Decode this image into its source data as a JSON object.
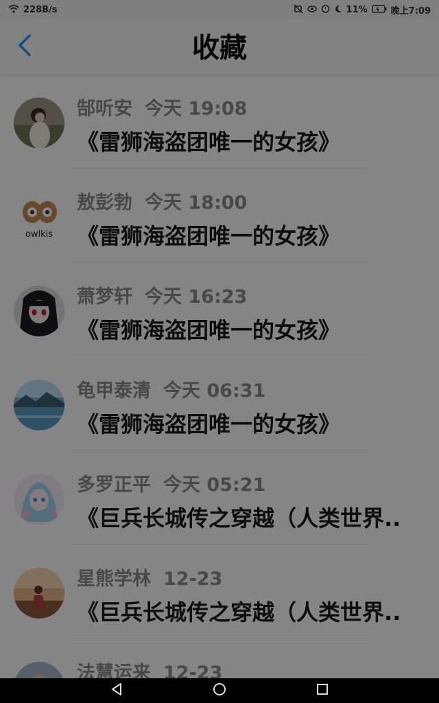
{
  "status_bar": {
    "network_speed": "228B/s",
    "battery": "11%",
    "time": "晚上7:09",
    "icons": [
      "wifi-icon",
      "mute-icon",
      "eye-icon",
      "alarm-icon",
      "moon-icon",
      "battery-icon"
    ]
  },
  "header": {
    "title": "收藏",
    "back_icon": "chevron-left-icon",
    "accent": "#2196f3"
  },
  "items": [
    {
      "name": "郜听安",
      "time": "今天 19:08",
      "message": "《雷狮海盗团唯一的女孩》",
      "avatar": "girl-photo"
    },
    {
      "name": "敖彭勃",
      "time": "今天 18:00",
      "message": "《雷狮海盗团唯一的女孩》",
      "avatar": "owl-logo"
    },
    {
      "name": "萧梦轩",
      "time": "今天 16:23",
      "message": "《雷狮海盗团唯一的女孩》",
      "avatar": "anime-girl"
    },
    {
      "name": "龟甲泰清",
      "time": "今天 06:31",
      "message": "《雷狮海盗团唯一的女孩》",
      "avatar": "lake-landscape"
    },
    {
      "name": "多罗正平",
      "time": "今天 05:21",
      "message": "《巨兵长城传之穿越（人类世界..",
      "avatar": "anime-illustration"
    },
    {
      "name": "星熊学林",
      "time": "12-23",
      "message": "《巨兵长城传之穿越（人类世界..",
      "avatar": "sunset-photo"
    },
    {
      "name": "法慧运来",
      "time": "12-23",
      "message": "",
      "avatar": "partial"
    }
  ],
  "nav_bar": {
    "buttons": [
      "back-triangle-icon",
      "home-circle-icon",
      "recents-square-icon"
    ]
  }
}
